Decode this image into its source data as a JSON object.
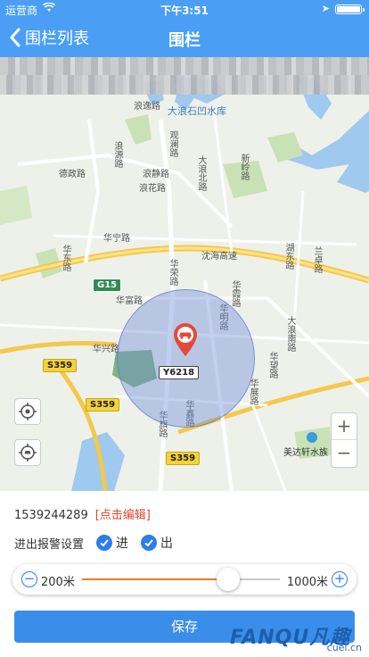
{
  "status_bar": {
    "carrier": "运营商",
    "time": "下午3:51"
  },
  "nav": {
    "back_label": "围栏列表",
    "title": "围栏"
  },
  "map": {
    "labels": {
      "reservoir": "大浪石凹水库",
      "langbo_rd": "浪逸路",
      "dezheng_rd": "德政路",
      "langjing_rd": "浪静路",
      "langhua_rd": "浪花路",
      "huaning_rd": "华宁路",
      "hudong_rd": "湖东路",
      "shenhai_hwy": "沈海高速",
      "huaxing_rd": "华兴路",
      "huarong_rd": "华荣路",
      "huafu_rd": "华富路",
      "huaxia_rd": "华霞路",
      "huaming_rd": "华明路",
      "dalang_rd": "大浪北路",
      "dalang_s_rd": "大浪南路",
      "huaqi_rd": "华旗路",
      "huazhan_rd": "华展路",
      "huaxin_rd": "华鑫路",
      "huawang_rd": "华望路",
      "xinling_rd": "新岭路",
      "langyuan_rd": "浪源路",
      "meida": "美达轩水族",
      "lanzhuo": "兰卓路",
      "huadong": "华东路",
      "guanlan": "观澜路"
    },
    "shields": {
      "g15": "G15",
      "s359_a": "S359",
      "s359_b": "S359",
      "s359_c": "S359",
      "y6218": "Y6218"
    },
    "zoom_in": "+",
    "zoom_out": "−"
  },
  "fence": {
    "phone": "1539244289",
    "edit_label": "[点击编辑]",
    "alarm_label": "进出报警设置",
    "in_label": "进",
    "out_label": "出",
    "in_checked": true,
    "out_checked": true
  },
  "radius": {
    "min_label": "200米",
    "max_label": "1000米",
    "value_fraction": 0.74
  },
  "save_label": "保存",
  "watermark": {
    "main": "FANQU凡趣",
    "sub": "cuel.cn"
  },
  "colors": {
    "header": "#4a9ff5",
    "accent": "#2b7de9",
    "edit": "#e0472d",
    "slider_fill": "#ef7b22",
    "fence": "#6e8cdc"
  }
}
